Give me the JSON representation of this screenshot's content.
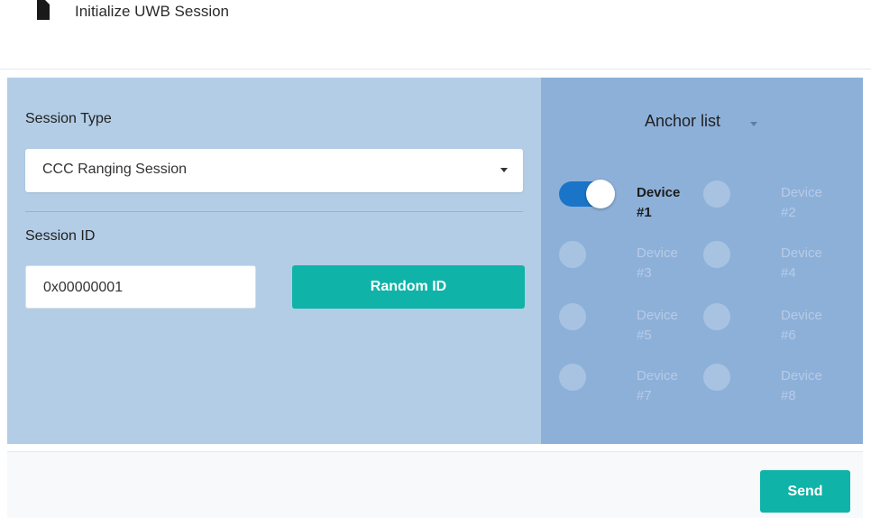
{
  "header": {
    "title": "Initialize UWB Session",
    "icon": "document-icon"
  },
  "form": {
    "session_type_label": "Session Type",
    "session_type_value": "CCC Ranging Session",
    "session_id_label": "Session ID",
    "session_id_value": "0x00000001",
    "random_id_button": "Random ID"
  },
  "anchors": {
    "title": "Anchor list",
    "devices": [
      {
        "name": "Device",
        "num": "#1",
        "enabled": true
      },
      {
        "name": "Device",
        "num": "#2",
        "enabled": false
      },
      {
        "name": "Device",
        "num": "#3",
        "enabled": false
      },
      {
        "name": "Device",
        "num": "#4",
        "enabled": false
      },
      {
        "name": "Device",
        "num": "#5",
        "enabled": false
      },
      {
        "name": "Device",
        "num": "#6",
        "enabled": false
      },
      {
        "name": "Device",
        "num": "#7",
        "enabled": false
      },
      {
        "name": "Device",
        "num": "#8",
        "enabled": false
      }
    ]
  },
  "footer": {
    "send_button": "Send"
  },
  "colors": {
    "accent": "#0fb3a8",
    "toggle_on": "#1a75c9",
    "left_panel": "#b3cde6",
    "right_panel": "#8db0d9"
  }
}
